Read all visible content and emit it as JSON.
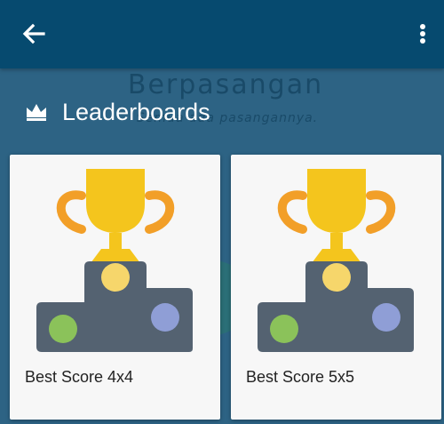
{
  "background": {
    "title": "Berpasangan",
    "subtitle": "Semua ada pasangannya."
  },
  "toolbar": {
    "back_icon": "arrow-left-icon",
    "menu_icon": "more-vertical-icon"
  },
  "section": {
    "icon": "crown-icon",
    "title": "Leaderboards"
  },
  "leaderboards": [
    {
      "label": "Best Score 4x4",
      "icon": "trophy-podium-icon"
    },
    {
      "label": "Best Score 5x5",
      "icon": "trophy-podium-icon"
    }
  ],
  "colors": {
    "appbar": "#064a6f",
    "background": "#2d6384",
    "card": "#f7f7f7",
    "trophy_gold": "#f4c51d",
    "trophy_handle": "#f29f28",
    "podium": "#546271",
    "dot_yellow": "#f6d66b",
    "dot_green": "#8bc25a",
    "dot_purple": "#8f9ed6"
  }
}
